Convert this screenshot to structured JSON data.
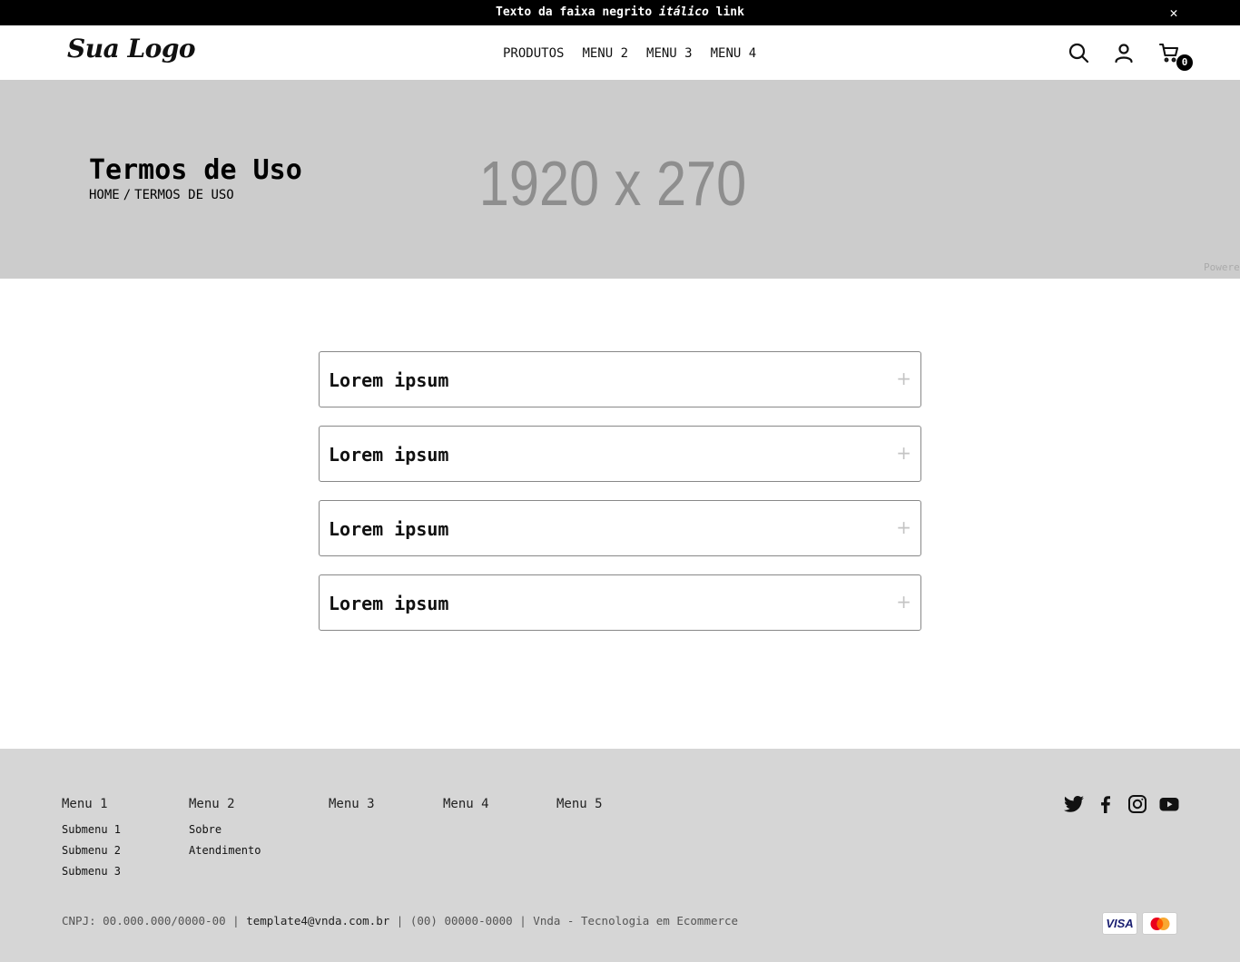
{
  "announcement": {
    "part1": "Texto da faixa negrito ",
    "italic": "itálico",
    "part2": " link",
    "close_glyph": "✕"
  },
  "header": {
    "logo_text": "Sua Logo",
    "nav": [
      "PRODUTOS",
      "MENU 2",
      "MENU 3",
      "MENU 4"
    ],
    "icons": [
      "search-icon",
      "user-icon",
      "cart-icon"
    ],
    "cart_count": "0"
  },
  "banner": {
    "placeholder_size": "1920 x 270",
    "title": "Termos de Uso",
    "breadcrumb": {
      "home": "HOME",
      "separator": "/",
      "current": "TERMOS DE USO"
    },
    "powered_text": "Powere"
  },
  "accordion": {
    "items": [
      {
        "title": "Lorem ipsum",
        "icon": "+"
      },
      {
        "title": "Lorem ipsum",
        "icon": "+"
      },
      {
        "title": "Lorem ipsum",
        "icon": "+"
      },
      {
        "title": "Lorem ipsum",
        "icon": "+"
      }
    ]
  },
  "footer": {
    "columns": [
      {
        "title": "Menu 1",
        "links": [
          "Submenu 1",
          "Submenu 2",
          "Submenu 3"
        ]
      },
      {
        "title": "Menu 2",
        "links": [
          "Sobre",
          "Atendimento"
        ]
      },
      {
        "title": "Menu 3",
        "links": []
      },
      {
        "title": "Menu 4",
        "links": []
      },
      {
        "title": "Menu 5",
        "links": []
      }
    ],
    "social": [
      "twitter-icon",
      "facebook-icon",
      "instagram-icon",
      "youtube-icon"
    ],
    "legal": {
      "cnpj": "CNPJ: 00.000.000/0000-00",
      "sep": " | ",
      "email": "template4@vnda.com.br",
      "phone": "(00) 00000-0000",
      "credit": "Vnda - Tecnologia em Ecommerce"
    },
    "payments": {
      "visa": "VISA",
      "mastercard": "mastercard-icon"
    }
  },
  "colors": {
    "topbar": "#000000",
    "banner": "#cccccc",
    "footer": "#d6d6d6",
    "text": "#111111"
  }
}
